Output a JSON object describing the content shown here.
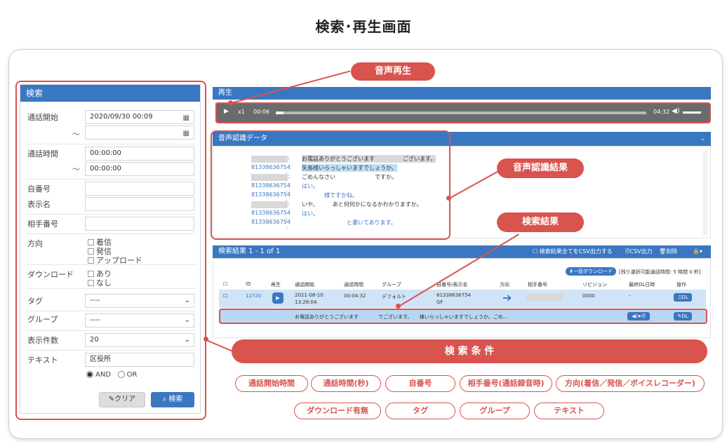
{
  "title": "検索･再生画面",
  "search": {
    "header": "検索",
    "call_start_label": "通話開始",
    "call_start_from": "2020/09/30 00:09",
    "call_start_to": "",
    "tilde": "～",
    "call_time_label": "通話時間",
    "call_time_from": "00:00:00",
    "call_time_to": "00:00:00",
    "own_number_label": "自番号",
    "display_name_label": "表示名",
    "partner_number_label": "相手番号",
    "direction_label": "方向",
    "direction_options": [
      "着信",
      "発信",
      "アップロード"
    ],
    "download_label": "ダウンロード",
    "download_options": [
      "あり",
      "なし"
    ],
    "tag_label": "タグ",
    "tag_value": "----",
    "group_label": "グループ",
    "group_value": "----",
    "count_label": "表示件数",
    "count_value": "20",
    "text_label": "テキスト",
    "text_value": "区役所",
    "and_label": "AND",
    "or_label": "OR",
    "clear_button": "クリア",
    "search_button": "検索"
  },
  "player": {
    "header": "再生",
    "speed": "x1",
    "current_time": "00:06",
    "total_time": "04:32",
    "progress": 0.02
  },
  "asr": {
    "header": "音声認識データ",
    "lines": [
      {
        "speaker": "",
        "text": "お電話ありがとうございます　　　　　ございます。"
      },
      {
        "speaker": "81338636754 :",
        "text": "矢島様いらっしゃいますでしょうか。"
      },
      {
        "speaker": "",
        "text": "ごめんなさい　　　　　　　ですか。"
      },
      {
        "speaker": "81338636754 :",
        "text": "はい。"
      },
      {
        "speaker": "81338636754 :",
        "text": "　　　　様ですかね。"
      },
      {
        "speaker": "",
        "text": "いや、　　　あと何何かになるかわかりますか。"
      },
      {
        "speaker": "81338636754 :",
        "text": "はい。"
      },
      {
        "speaker": "81338636754 :",
        "text": "　　　　　　　　と書いてあります。"
      }
    ]
  },
  "results": {
    "header": "検索結果 1 - 1 of 1",
    "csv_all": "検索結果全てをCSV出力する",
    "csv_out": "CSV出力",
    "delete": "削除",
    "bulk_download": "一括ダウンロード",
    "remaining": "[残り選択可能通話時間: 5 時間 0 秒]",
    "columns": [
      "ID",
      "再生",
      "通話開始",
      "通話時間",
      "グループ",
      "自番号/表示名",
      "方向",
      "相手番号",
      "リビジョン",
      "最終DL日時",
      "操作"
    ],
    "row": {
      "id": "12720",
      "start_date": "2021-08-10",
      "start_time": "13:26:04",
      "duration": "00:04:32",
      "group": "デフォルト",
      "number": "81338636754",
      "name": "GF",
      "revision": "0000",
      "last_dl": "-",
      "dl": "DL"
    },
    "snippet": "お電話ありがとうございます　　　　でございます。　　様いらっしゃいますでしょうか。ごめ..."
  },
  "annotations": {
    "playback": "音声再生",
    "asr_result": "音声認識結果",
    "search_result": "検索結果",
    "search_conditions": "検 索 条 件",
    "tags": [
      "通話開始時間",
      "通話時間(秒)",
      "自番号",
      "相手番号(通話録音時)",
      "方向(着信／発信／ボイスレコーダー)",
      "ダウンロード有無",
      "タグ",
      "グループ",
      "テキスト"
    ]
  },
  "colors": {
    "accent": "#3a77c2",
    "annotation": "#d9534f"
  }
}
